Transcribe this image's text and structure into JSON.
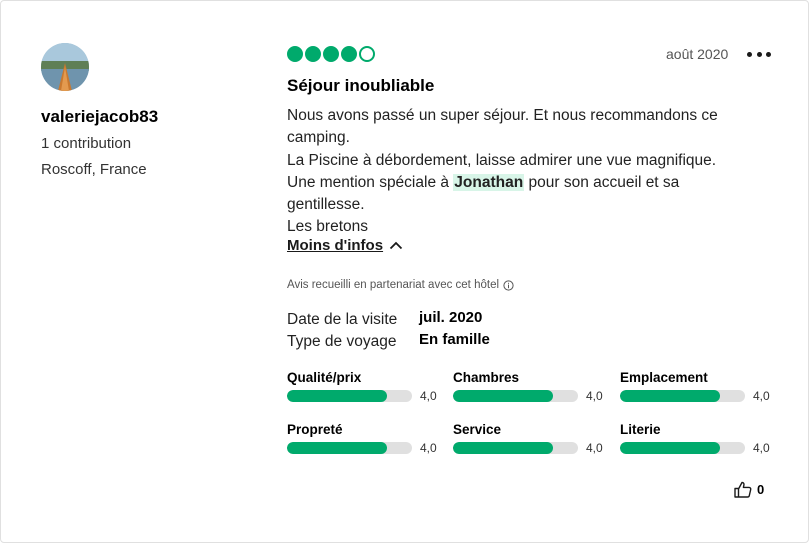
{
  "user": {
    "name": "valeriejacob83",
    "contributions": "1 contribution",
    "location": "Roscoff, France"
  },
  "review": {
    "rating_bubbles": 4,
    "rating_max": 5,
    "date": "août 2020",
    "title": "Séjour inoubliable",
    "lines": [
      "Nous avons passé un super séjour. Et nous recommandons ce camping.",
      "La Piscine à débordement, laisse admirer une vue magnifique."
    ],
    "mention_prefix": "Une mention spéciale à ",
    "mention_name": "Jonathan",
    "mention_suffix": " pour son accueil et sa gentillesse.",
    "signature": "Les bretons",
    "less_label": "Moins d'infos",
    "partner_note": "Avis recueilli en partenariat avec cet hôtel"
  },
  "visit": {
    "date_label": "Date de la visite",
    "date_value": "juil. 2020",
    "type_label": "Type de voyage",
    "type_value": "En famille"
  },
  "subratings": [
    {
      "label": "Qualité/prix",
      "value": "4,0",
      "fraction": 0.8
    },
    {
      "label": "Chambres",
      "value": "4,0",
      "fraction": 0.8
    },
    {
      "label": "Emplacement",
      "value": "4,0",
      "fraction": 0.8
    },
    {
      "label": "Propreté",
      "value": "4,0",
      "fraction": 0.8
    },
    {
      "label": "Service",
      "value": "4,0",
      "fraction": 0.8
    },
    {
      "label": "Literie",
      "value": "4,0",
      "fraction": 0.8
    }
  ],
  "helpful": {
    "count": "0",
    "icon": "thumbs-up-icon"
  },
  "colors": {
    "accent": "#00aa6c",
    "highlight": "#d8f5e8",
    "track": "#e0e0e0"
  }
}
